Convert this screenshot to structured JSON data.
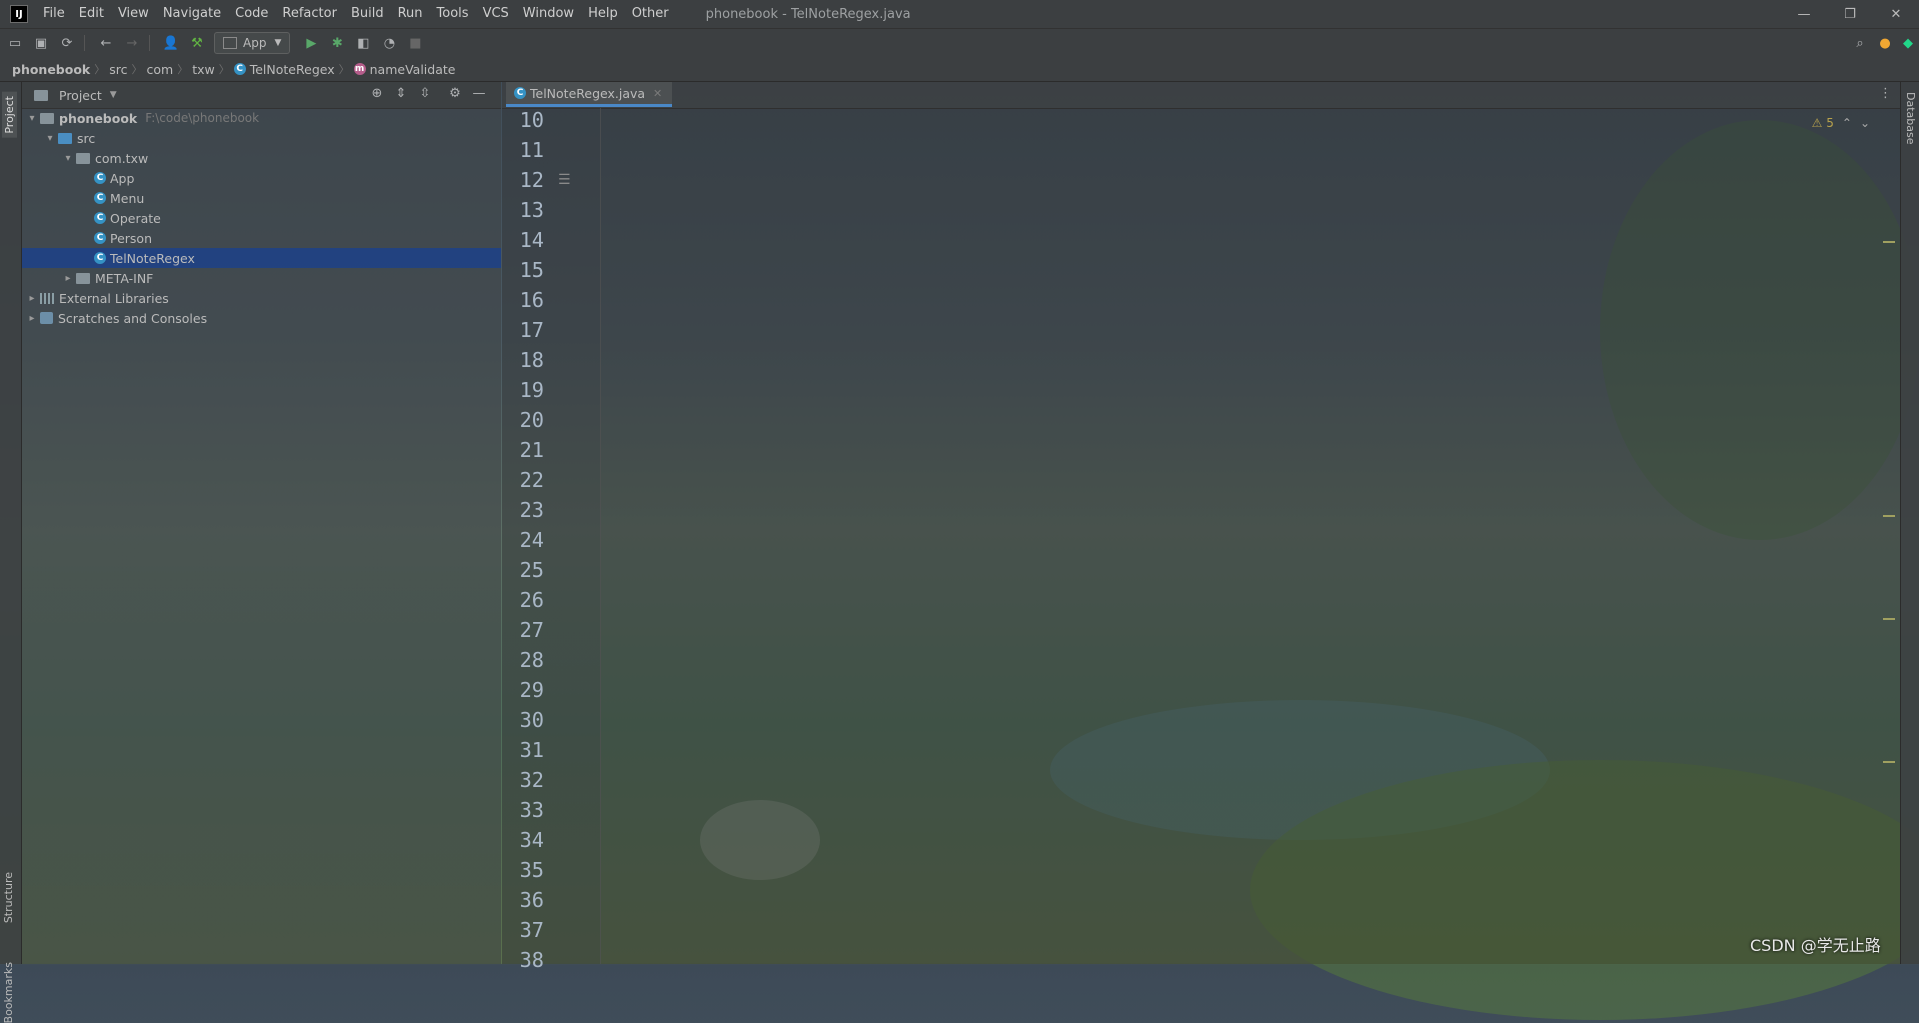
{
  "menubar": {
    "logo": "IJ",
    "items": [
      "File",
      "Edit",
      "View",
      "Navigate",
      "Code",
      "Refactor",
      "Build",
      "Run",
      "Tools",
      "VCS",
      "Window",
      "Help",
      "Other"
    ],
    "window_title": "phonebook - TelNoteRegex.java",
    "controls": {
      "minimize": "—",
      "restore": "❐",
      "close": "✕"
    }
  },
  "toolbar": {
    "run_config": "App",
    "icons": [
      "open-icon",
      "save-icon",
      "sync-icon",
      "back-icon",
      "forward-icon",
      "user-icon",
      "build-hammer-icon",
      "run-icon",
      "debug-icon",
      "coverage-icon",
      "profile-icon",
      "stop-icon",
      "search-icon",
      "update-icon",
      "jetbrains-icon"
    ]
  },
  "breadcrumb": {
    "items": [
      "phonebook",
      "src",
      "com",
      "txw",
      "TelNoteRegex",
      "nameValidate"
    ]
  },
  "left_strip": {
    "project_tab": "Project",
    "structure_tab": "Structure",
    "bookmarks_tab": "Bookmarks"
  },
  "right_strip": {
    "database_tab": "Database"
  },
  "project_panel": {
    "title": "Project",
    "tree": [
      {
        "label": "phonebook",
        "path": "F:\\code\\phonebook"
      },
      {
        "label": "src"
      },
      {
        "label": "com.txw"
      },
      {
        "label": "App"
      },
      {
        "label": "Menu"
      },
      {
        "label": "Operate"
      },
      {
        "label": "Person"
      },
      {
        "label": "TelNoteRegex"
      },
      {
        "label": "META-INF"
      },
      {
        "label": "External Libraries"
      },
      {
        "label": "Scratches and Consoles"
      }
    ]
  },
  "editor": {
    "tab_label": "TelNoteRegex.java",
    "inspection": "⚠ 5",
    "line_numbers": [
      "10",
      "11",
      "12",
      "13",
      "14",
      "15",
      "16",
      "17",
      "18",
      "19",
      "20",
      "21",
      "22",
      "23",
      "24",
      "25",
      "26",
      "27",
      "28",
      "29",
      "30",
      "31",
      "32",
      "33",
      "34",
      "35",
      "36",
      "37",
      "38"
    ]
  },
  "watermark": "CSDN @学无止路"
}
